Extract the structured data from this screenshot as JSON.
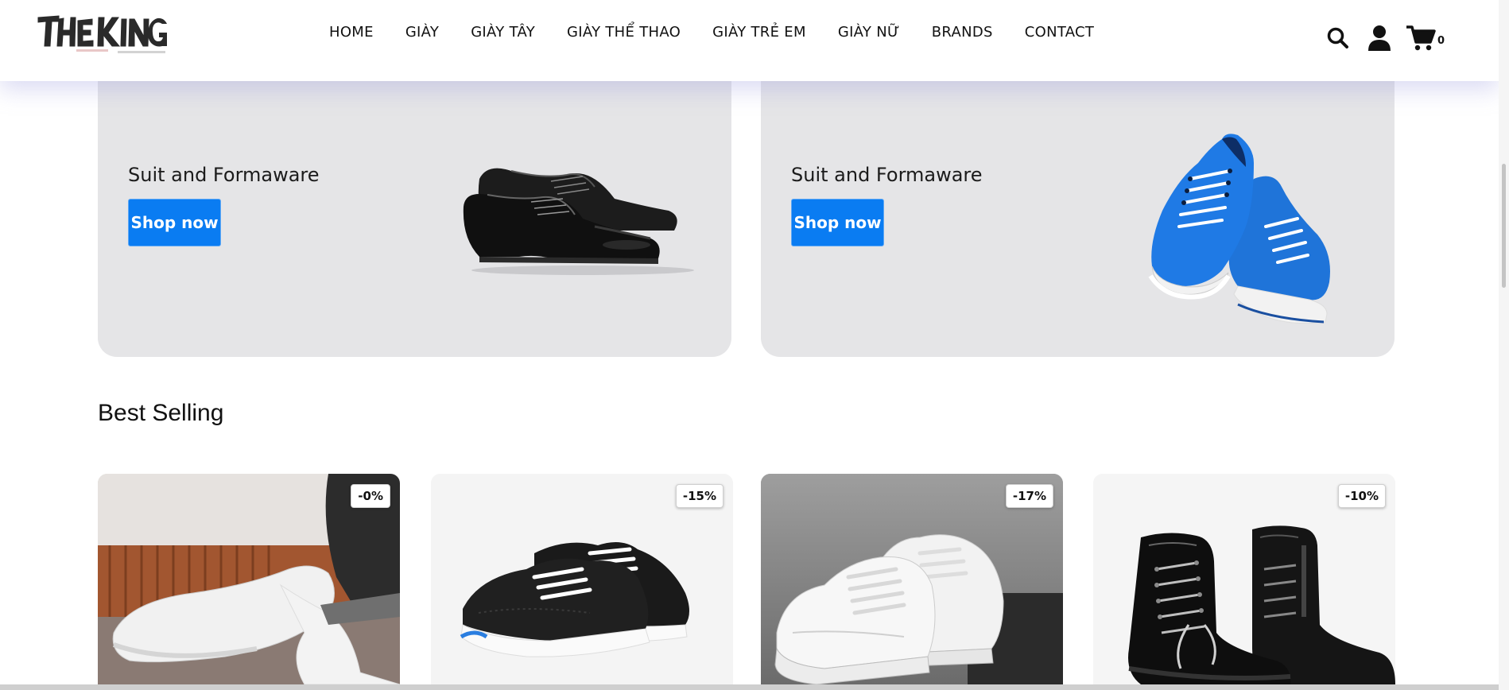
{
  "header": {
    "logo_text": "THE KING",
    "nav": [
      "HOME",
      "GIÀY",
      "GIÀY TÂY",
      "GIÀY THỂ THAO",
      "GIÀY TRẺ EM",
      "GIÀY NỮ",
      "BRANDS",
      "CONTACT"
    ],
    "cart_count": "0",
    "icons": [
      "search-icon",
      "user-icon",
      "cart-icon"
    ]
  },
  "banners": [
    {
      "title": "Suit and Formaware",
      "button": "Shop now",
      "image": "black-dress-shoe"
    },
    {
      "title": "Suit and Formaware",
      "button": "Shop now",
      "image": "blue-sneakers"
    }
  ],
  "best_selling": {
    "title": "Best Selling",
    "products": [
      {
        "discount": "-0%",
        "image": "white-sneaker-on-foot"
      },
      {
        "discount": "-15%",
        "image": "black-running-shoes"
      },
      {
        "discount": "-17%",
        "image": "white-sneakers"
      },
      {
        "discount": "-10%",
        "image": "black-leather-boots"
      }
    ]
  },
  "colors": {
    "accent": "#0a7cf2",
    "banner_bg": "#e5e5e7",
    "text": "#111111"
  }
}
